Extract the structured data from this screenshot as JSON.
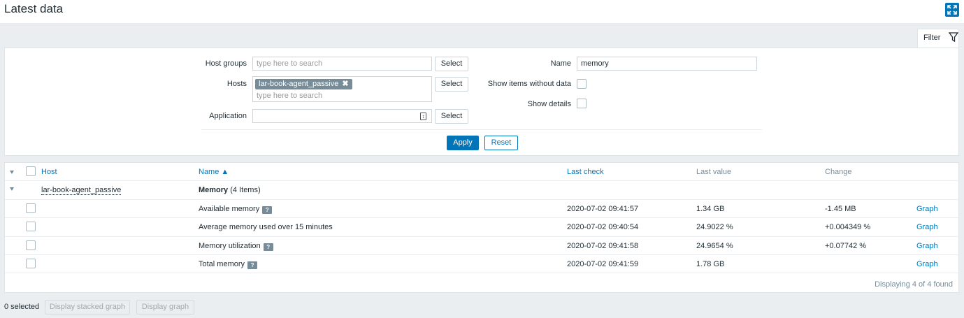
{
  "header": {
    "title": "Latest data",
    "fullscreen_icon": "fullscreen-icon"
  },
  "filter_tab": {
    "label": "Filter",
    "icon": "filter-icon"
  },
  "filter": {
    "host_groups": {
      "label": "Host groups",
      "placeholder": "type here to search",
      "select_label": "Select"
    },
    "hosts": {
      "label": "Hosts",
      "chip": "lar-book-agent_passive",
      "chip_remove": "✖",
      "placeholder": "type here to search",
      "select_label": "Select"
    },
    "application": {
      "label": "Application",
      "value": "",
      "select_label": "Select"
    },
    "name": {
      "label": "Name",
      "value": "memory"
    },
    "show_items_without_data": {
      "label": "Show items without data",
      "checked": false
    },
    "show_details": {
      "label": "Show details",
      "checked": false
    },
    "apply_label": "Apply",
    "reset_label": "Reset"
  },
  "table": {
    "columns": {
      "host": "Host",
      "name": "Name ▲",
      "last_check": "Last check",
      "last_value": "Last value",
      "change": "Change"
    },
    "group": {
      "host": "lar-book-agent_passive",
      "app_name": "Memory",
      "app_count": " (4 Items)"
    },
    "rows": [
      {
        "name": "Available memory",
        "help": "?",
        "last_check": "2020-07-02 09:41:57",
        "last_value": "1.34 GB",
        "change": "-1.45 MB",
        "graph": "Graph"
      },
      {
        "name": "Average memory used over 15 minutes",
        "help": "",
        "last_check": "2020-07-02 09:40:54",
        "last_value": "24.9022 %",
        "change": "+0.004349 %",
        "graph": "Graph"
      },
      {
        "name": "Memory utilization",
        "help": "?",
        "last_check": "2020-07-02 09:41:58",
        "last_value": "24.9654 %",
        "change": "+0.07742 %",
        "graph": "Graph"
      },
      {
        "name": "Total memory",
        "help": "?",
        "last_check": "2020-07-02 09:41:59",
        "last_value": "1.78 GB",
        "change": "",
        "graph": "Graph"
      }
    ],
    "footer": "Displaying 4 of 4 found"
  },
  "bottom": {
    "selected": "0 selected",
    "stacked_graph": "Display stacked graph",
    "graph": "Display graph"
  },
  "colors": {
    "accent": "#0275b8",
    "background": "#ebeef0",
    "chip": "#768d99"
  }
}
